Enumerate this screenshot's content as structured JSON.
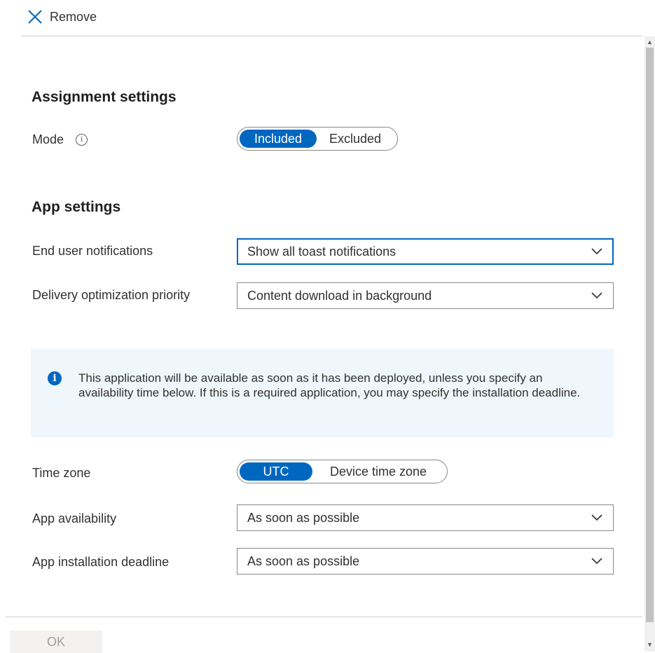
{
  "toolbar": {
    "remove_label": "Remove"
  },
  "assignment_settings": {
    "heading": "Assignment settings",
    "mode": {
      "label": "Mode",
      "info_icon": "info-icon",
      "options": [
        "Included",
        "Excluded"
      ],
      "selected": "Included"
    }
  },
  "app_settings": {
    "heading": "App settings",
    "end_user_notifications": {
      "label": "End user notifications",
      "value": "Show all toast notifications"
    },
    "delivery_optimization": {
      "label": "Delivery optimization priority",
      "value": "Content download in background"
    }
  },
  "info_message": "This application will be available as soon as it has been deployed, unless you specify an availability time below. If this is a required application, you may specify the installation deadline.",
  "time_zone": {
    "label": "Time zone",
    "options": [
      "UTC",
      "Device time zone"
    ],
    "selected": "UTC"
  },
  "app_availability": {
    "label": "App availability",
    "value": "As soon as possible"
  },
  "app_installation_deadline": {
    "label": "App installation deadline",
    "value": "As soon as possible"
  },
  "footer": {
    "ok_label": "OK"
  },
  "colors": {
    "accent": "#0067c0",
    "info_background": "#eff6fc",
    "border": "#8a8886"
  }
}
